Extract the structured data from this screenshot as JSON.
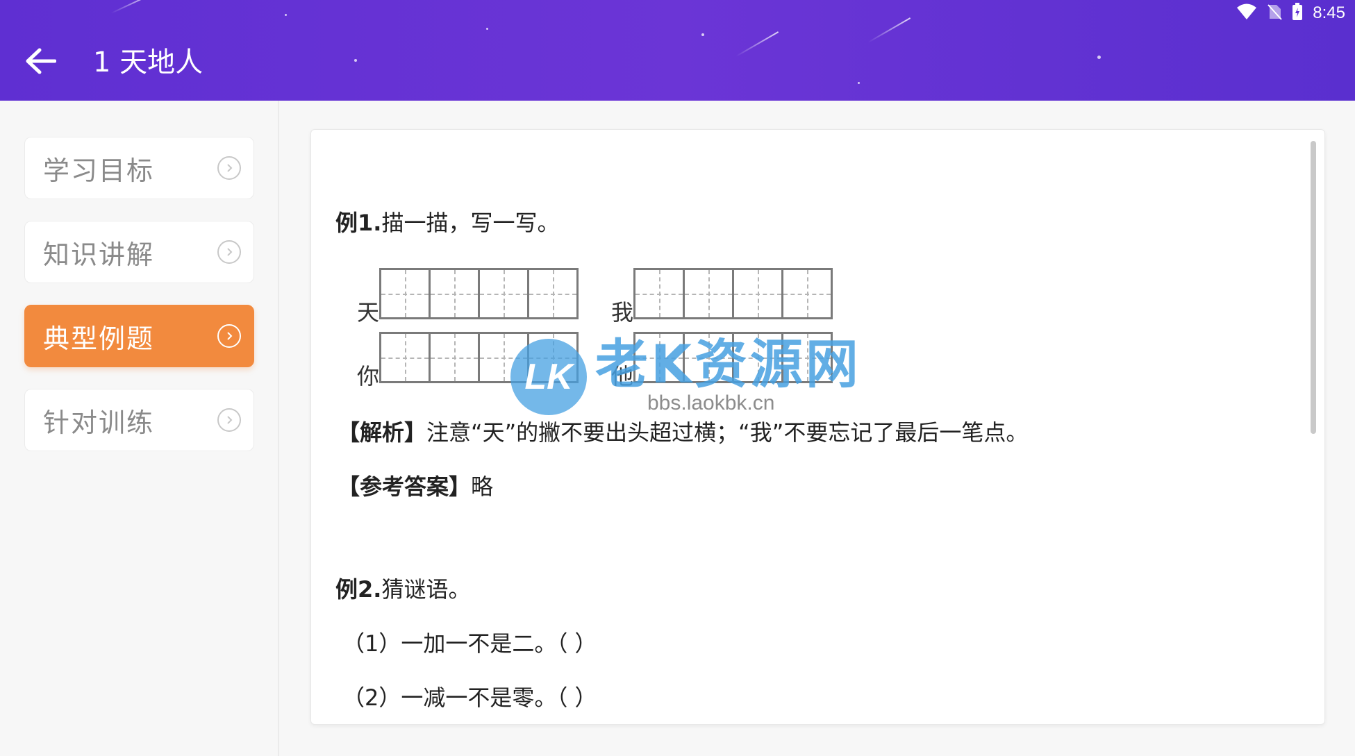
{
  "status_bar": {
    "time": "8:45"
  },
  "header": {
    "title": "1 天地人"
  },
  "sidebar": {
    "items": [
      {
        "label": "学习目标",
        "active": false
      },
      {
        "label": "知识讲解",
        "active": false
      },
      {
        "label": "典型例题",
        "active": true
      },
      {
        "label": "针对训练",
        "active": false
      }
    ]
  },
  "colors": {
    "header": "#6232d4",
    "active": "#f28a3e"
  },
  "content": {
    "example1": {
      "heading": "例1.",
      "prompt": "描一描，写一写。",
      "grid_chars": [
        "天",
        "我",
        "你",
        "他"
      ],
      "analysis_label": "【解析】",
      "analysis_text": "注意“天”的撇不要出头超过横；“我”不要忘记了最后一笔点。",
      "answer_label": "【参考答案】",
      "answer_text": "略"
    },
    "example2": {
      "heading": "例2.",
      "prompt": "猜谜语。",
      "q1": "（1）一加一不是二。（ ）",
      "q2": "（2）一减一不是零。（ ）"
    }
  },
  "watermark": {
    "logo": "LK",
    "name": "老K资源网",
    "url": "bbs.laokbk.cn"
  }
}
